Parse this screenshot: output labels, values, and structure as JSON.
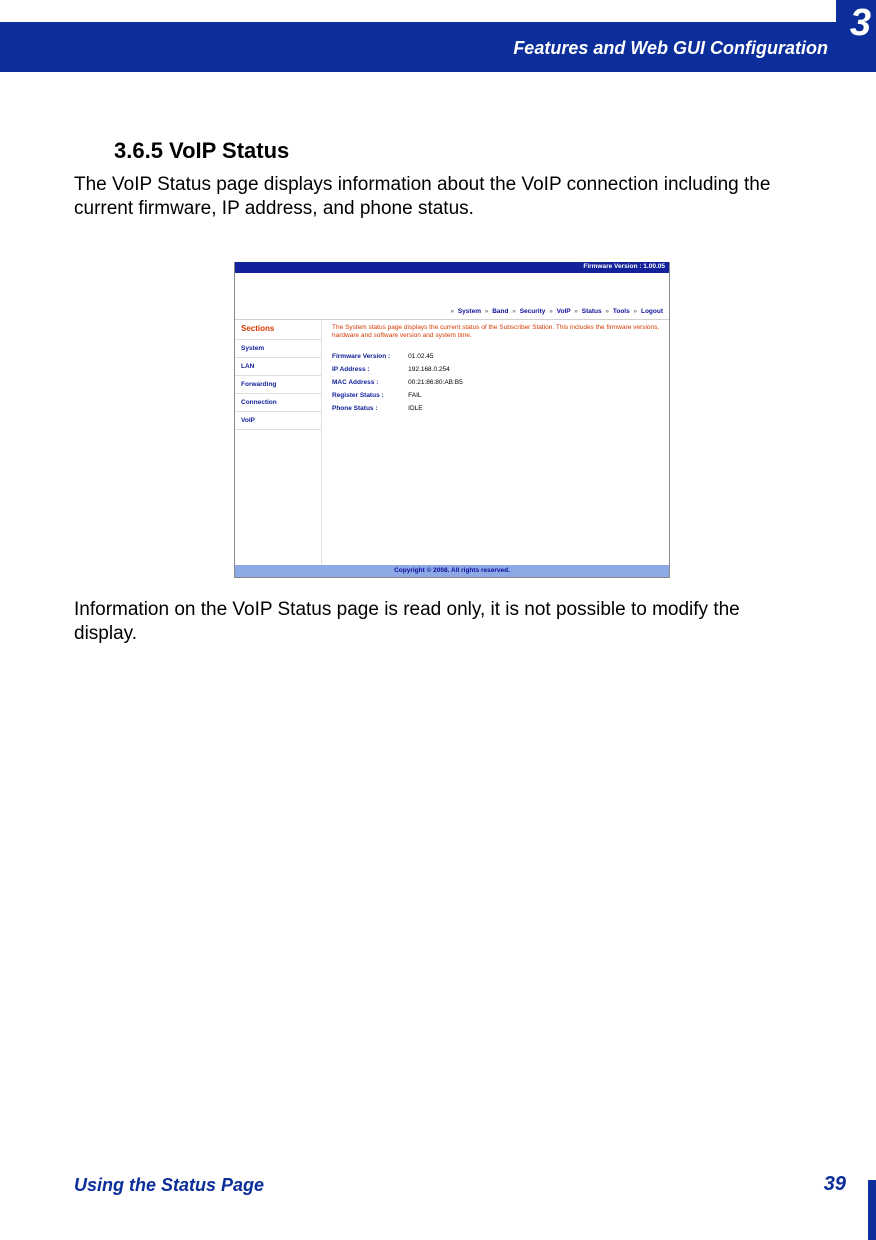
{
  "chapter": {
    "number": "3",
    "title": "Features and Web GUI Configuration"
  },
  "section": {
    "heading": "3.6.5 VoIP Status",
    "para1": "The VoIP Status page displays information about the VoIP connection including the current firmware, IP address, and phone status.",
    "para2": "Information on the VoIP Status page is read only, it is not possible to modify the display."
  },
  "gui": {
    "firmware_bar": "Firmware Version : 1.00.05",
    "nav": [
      "System",
      "Band",
      "Security",
      "VoIP",
      "Status",
      "Tools",
      "Logout"
    ],
    "sidebar_title": "Sections",
    "sidebar_items": [
      "System",
      "LAN",
      "Forwarding",
      "Connection",
      "VoIP"
    ],
    "intro": "The System status page displays the current status of the Subscriber Station. This includes the firmware versions, hardware and software version and system time.",
    "rows": [
      {
        "label": "Firmware Version :",
        "value": "01.02.45"
      },
      {
        "label": "IP Address :",
        "value": "192.168.0.254"
      },
      {
        "label": "MAC Address :",
        "value": "00:21:86:80:AB:B5"
      },
      {
        "label": "Register Status :",
        "value": "FAIL"
      },
      {
        "label": "Phone Status :",
        "value": "IDLE"
      }
    ],
    "copyright": "Copyright © 2008.  All rights reserved."
  },
  "footer": {
    "text": "Using the Status Page",
    "page": "39"
  }
}
